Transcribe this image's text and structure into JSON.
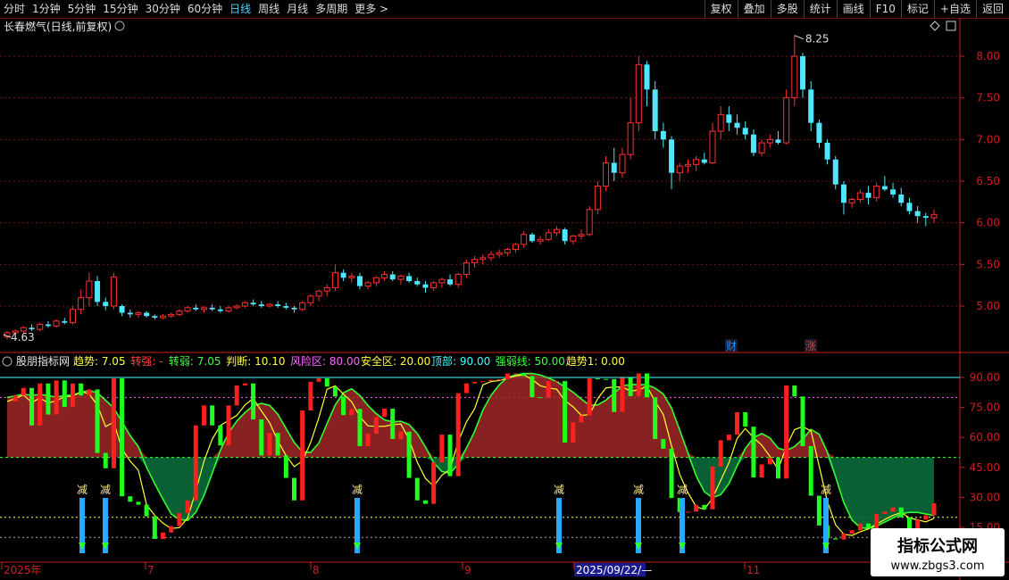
{
  "toolbar": {
    "periods": [
      {
        "label": "分时",
        "active": false
      },
      {
        "label": "1分钟",
        "active": false
      },
      {
        "label": "5分钟",
        "active": false
      },
      {
        "label": "15分钟",
        "active": false
      },
      {
        "label": "30分钟",
        "active": false
      },
      {
        "label": "60分钟",
        "active": false
      },
      {
        "label": "日线",
        "active": true
      },
      {
        "label": "周线",
        "active": false
      },
      {
        "label": "月线",
        "active": false
      },
      {
        "label": "多周期",
        "active": false
      },
      {
        "label": "更多 >",
        "active": false
      }
    ],
    "buttons": [
      "复权",
      "叠加",
      "多股",
      "统计",
      "画线",
      "F10",
      "标记",
      "+自选",
      "返回"
    ]
  },
  "main_panel": {
    "title": "长春燃气(日线,前复权)",
    "price_labels": [
      "8.00",
      "7.50",
      "7.00",
      "6.50",
      "6.00",
      "5.50",
      "5.00"
    ],
    "high_marker": "8.25",
    "low_marker": "4.63",
    "badges": [
      {
        "text": "财",
        "color": "#1e90ff"
      },
      {
        "text": "涨",
        "color": "#ff3030"
      }
    ]
  },
  "indicator_panel": {
    "name": "股朋指标网",
    "readouts": [
      {
        "label": "趋势: 7.05",
        "color": "#ffff40"
      },
      {
        "label": "转强: -",
        "color": "#ff4040"
      },
      {
        "label": "转弱: 7.05",
        "color": "#40ff40"
      },
      {
        "label": "判断: 10.10",
        "color": "#ffff40"
      },
      {
        "label": "风险区: 80.00",
        "color": "#ff66ff"
      },
      {
        "label": "安全区: 20.00",
        "color": "#ffff40"
      },
      {
        "label": "顶部: 90.00",
        "color": "#40ffff"
      },
      {
        "label": "强弱线: 50.00",
        "color": "#40ff40"
      },
      {
        "label": "趋势1: 0.00",
        "color": "#ffff40"
      }
    ],
    "y_labels": [
      "90.00",
      "75.00",
      "60.00",
      "45.00",
      "30.00",
      "15.00"
    ],
    "signal_label": "减"
  },
  "time_axis": {
    "labels": [
      "2025年",
      "7",
      "8",
      "9",
      "2025/09/22/—",
      "11"
    ]
  },
  "watermark": {
    "title": "指标公式网",
    "url": "www.zbgs3.com"
  },
  "colors": {
    "up": "#ff3030",
    "down": "#50e6ff",
    "grid": "#7a1010",
    "axis": "#cc2020"
  },
  "chart_data": {
    "type": "candlestick",
    "ylim": [
      4.6,
      8.3
    ],
    "candles": [
      [
        4.63,
        4.7,
        4.6,
        4.68
      ],
      [
        4.68,
        4.72,
        4.65,
        4.7
      ],
      [
        4.7,
        4.76,
        4.68,
        4.74
      ],
      [
        4.74,
        4.78,
        4.7,
        4.72
      ],
      [
        4.72,
        4.8,
        4.7,
        4.78
      ],
      [
        4.78,
        4.82,
        4.74,
        4.76
      ],
      [
        4.76,
        4.84,
        4.74,
        4.82
      ],
      [
        4.82,
        4.86,
        4.78,
        4.8
      ],
      [
        4.8,
        5.0,
        4.78,
        4.96
      ],
      [
        4.96,
        5.2,
        4.9,
        5.1
      ],
      [
        5.1,
        5.4,
        5.0,
        5.3
      ],
      [
        5.3,
        5.36,
        5.0,
        5.05
      ],
      [
        5.05,
        5.1,
        4.95,
        5.0
      ],
      [
        5.0,
        5.4,
        4.96,
        5.35
      ],
      [
        5.0,
        5.02,
        4.88,
        4.92
      ],
      [
        4.92,
        4.96,
        4.86,
        4.9
      ],
      [
        4.9,
        4.94,
        4.86,
        4.92
      ],
      [
        4.92,
        4.94,
        4.86,
        4.88
      ],
      [
        4.88,
        4.9,
        4.84,
        4.86
      ],
      [
        4.86,
        4.9,
        4.84,
        4.88
      ],
      [
        4.88,
        4.92,
        4.86,
        4.9
      ],
      [
        4.9,
        4.96,
        4.88,
        4.94
      ],
      [
        4.94,
        5.0,
        4.92,
        4.98
      ],
      [
        4.98,
        5.02,
        4.94,
        4.96
      ],
      [
        4.96,
        5.0,
        4.92,
        4.98
      ],
      [
        4.98,
        5.02,
        4.94,
        4.96
      ],
      [
        4.96,
        5.0,
        4.92,
        4.94
      ],
      [
        4.94,
        5.0,
        4.92,
        4.98
      ],
      [
        4.98,
        5.02,
        4.96,
        5.0
      ],
      [
        5.0,
        5.06,
        4.98,
        5.04
      ],
      [
        5.04,
        5.08,
        5.0,
        5.02
      ],
      [
        5.02,
        5.06,
        4.98,
        5.0
      ],
      [
        5.0,
        5.04,
        4.98,
        5.02
      ],
      [
        5.02,
        5.06,
        4.98,
        5.0
      ],
      [
        5.0,
        5.04,
        4.96,
        4.98
      ],
      [
        4.98,
        5.0,
        4.92,
        4.96
      ],
      [
        4.96,
        5.06,
        4.94,
        5.04
      ],
      [
        5.04,
        5.14,
        5.0,
        5.12
      ],
      [
        5.12,
        5.2,
        5.06,
        5.18
      ],
      [
        5.18,
        5.26,
        5.12,
        5.22
      ],
      [
        5.22,
        5.5,
        5.18,
        5.4
      ],
      [
        5.4,
        5.44,
        5.3,
        5.34
      ],
      [
        5.34,
        5.4,
        5.28,
        5.36
      ],
      [
        5.36,
        5.4,
        5.2,
        5.24
      ],
      [
        5.24,
        5.3,
        5.2,
        5.28
      ],
      [
        5.28,
        5.36,
        5.24,
        5.34
      ],
      [
        5.34,
        5.42,
        5.3,
        5.38
      ],
      [
        5.38,
        5.42,
        5.3,
        5.32
      ],
      [
        5.32,
        5.38,
        5.26,
        5.36
      ],
      [
        5.36,
        5.4,
        5.28,
        5.3
      ],
      [
        5.3,
        5.34,
        5.24,
        5.26
      ],
      [
        5.26,
        5.3,
        5.16,
        5.22
      ],
      [
        5.22,
        5.3,
        5.18,
        5.28
      ],
      [
        5.28,
        5.34,
        5.22,
        5.32
      ],
      [
        5.32,
        5.38,
        5.24,
        5.26
      ],
      [
        5.26,
        5.4,
        5.22,
        5.38
      ],
      [
        5.38,
        5.56,
        5.34,
        5.52
      ],
      [
        5.52,
        5.6,
        5.46,
        5.56
      ],
      [
        5.56,
        5.62,
        5.5,
        5.58
      ],
      [
        5.58,
        5.66,
        5.54,
        5.62
      ],
      [
        5.62,
        5.68,
        5.58,
        5.64
      ],
      [
        5.64,
        5.7,
        5.6,
        5.68
      ],
      [
        5.68,
        5.76,
        5.64,
        5.74
      ],
      [
        5.74,
        5.9,
        5.7,
        5.86
      ],
      [
        5.86,
        5.88,
        5.76,
        5.78
      ],
      [
        5.78,
        5.84,
        5.74,
        5.8
      ],
      [
        5.8,
        5.92,
        5.78,
        5.88
      ],
      [
        5.88,
        5.96,
        5.84,
        5.92
      ],
      [
        5.92,
        5.94,
        5.74,
        5.78
      ],
      [
        5.78,
        5.86,
        5.74,
        5.84
      ],
      [
        5.84,
        5.92,
        5.8,
        5.86
      ],
      [
        5.86,
        6.2,
        5.84,
        6.16
      ],
      [
        6.16,
        6.5,
        6.1,
        6.44
      ],
      [
        6.44,
        6.8,
        6.38,
        6.72
      ],
      [
        6.72,
        6.9,
        6.5,
        6.6
      ],
      [
        6.6,
        6.9,
        6.54,
        6.82
      ],
      [
        6.82,
        7.5,
        6.76,
        7.2
      ],
      [
        7.2,
        8.0,
        7.1,
        7.9
      ],
      [
        7.9,
        7.94,
        7.4,
        7.6
      ],
      [
        7.6,
        7.7,
        7.0,
        7.1
      ],
      [
        7.1,
        7.2,
        6.9,
        7.0
      ],
      [
        7.0,
        7.04,
        6.4,
        6.6
      ],
      [
        6.6,
        6.72,
        6.5,
        6.68
      ],
      [
        6.68,
        6.76,
        6.6,
        6.7
      ],
      [
        6.7,
        6.8,
        6.62,
        6.76
      ],
      [
        6.76,
        6.84,
        6.7,
        6.72
      ],
      [
        6.72,
        7.2,
        6.7,
        7.1
      ],
      [
        7.1,
        7.4,
        7.0,
        7.3
      ],
      [
        7.3,
        7.4,
        7.1,
        7.2
      ],
      [
        7.2,
        7.3,
        7.06,
        7.14
      ],
      [
        7.14,
        7.22,
        7.0,
        7.06
      ],
      [
        7.06,
        7.12,
        6.8,
        6.84
      ],
      [
        6.84,
        7.0,
        6.8,
        6.96
      ],
      [
        6.96,
        7.06,
        6.9,
        7.0
      ],
      [
        7.0,
        7.1,
        6.94,
        6.96
      ],
      [
        6.96,
        7.6,
        6.94,
        7.5
      ],
      [
        7.5,
        8.25,
        7.4,
        8.0
      ],
      [
        8.0,
        8.04,
        7.5,
        7.6
      ],
      [
        7.6,
        7.7,
        7.1,
        7.2
      ],
      [
        7.2,
        7.24,
        6.9,
        6.96
      ],
      [
        6.96,
        7.0,
        6.7,
        6.76
      ],
      [
        6.76,
        6.8,
        6.4,
        6.46
      ],
      [
        6.46,
        6.5,
        6.1,
        6.24
      ],
      [
        6.24,
        6.3,
        6.18,
        6.28
      ],
      [
        6.28,
        6.4,
        6.24,
        6.36
      ],
      [
        6.36,
        6.44,
        6.22,
        6.3
      ],
      [
        6.3,
        6.48,
        6.26,
        6.44
      ],
      [
        6.44,
        6.56,
        6.38,
        6.4
      ],
      [
        6.4,
        6.48,
        6.3,
        6.34
      ],
      [
        6.34,
        6.42,
        6.2,
        6.24
      ],
      [
        6.24,
        6.3,
        6.1,
        6.14
      ],
      [
        6.14,
        6.2,
        6.0,
        6.08
      ],
      [
        6.08,
        6.12,
        5.96,
        6.06
      ],
      [
        6.06,
        6.16,
        6.0,
        6.1
      ]
    ]
  }
}
